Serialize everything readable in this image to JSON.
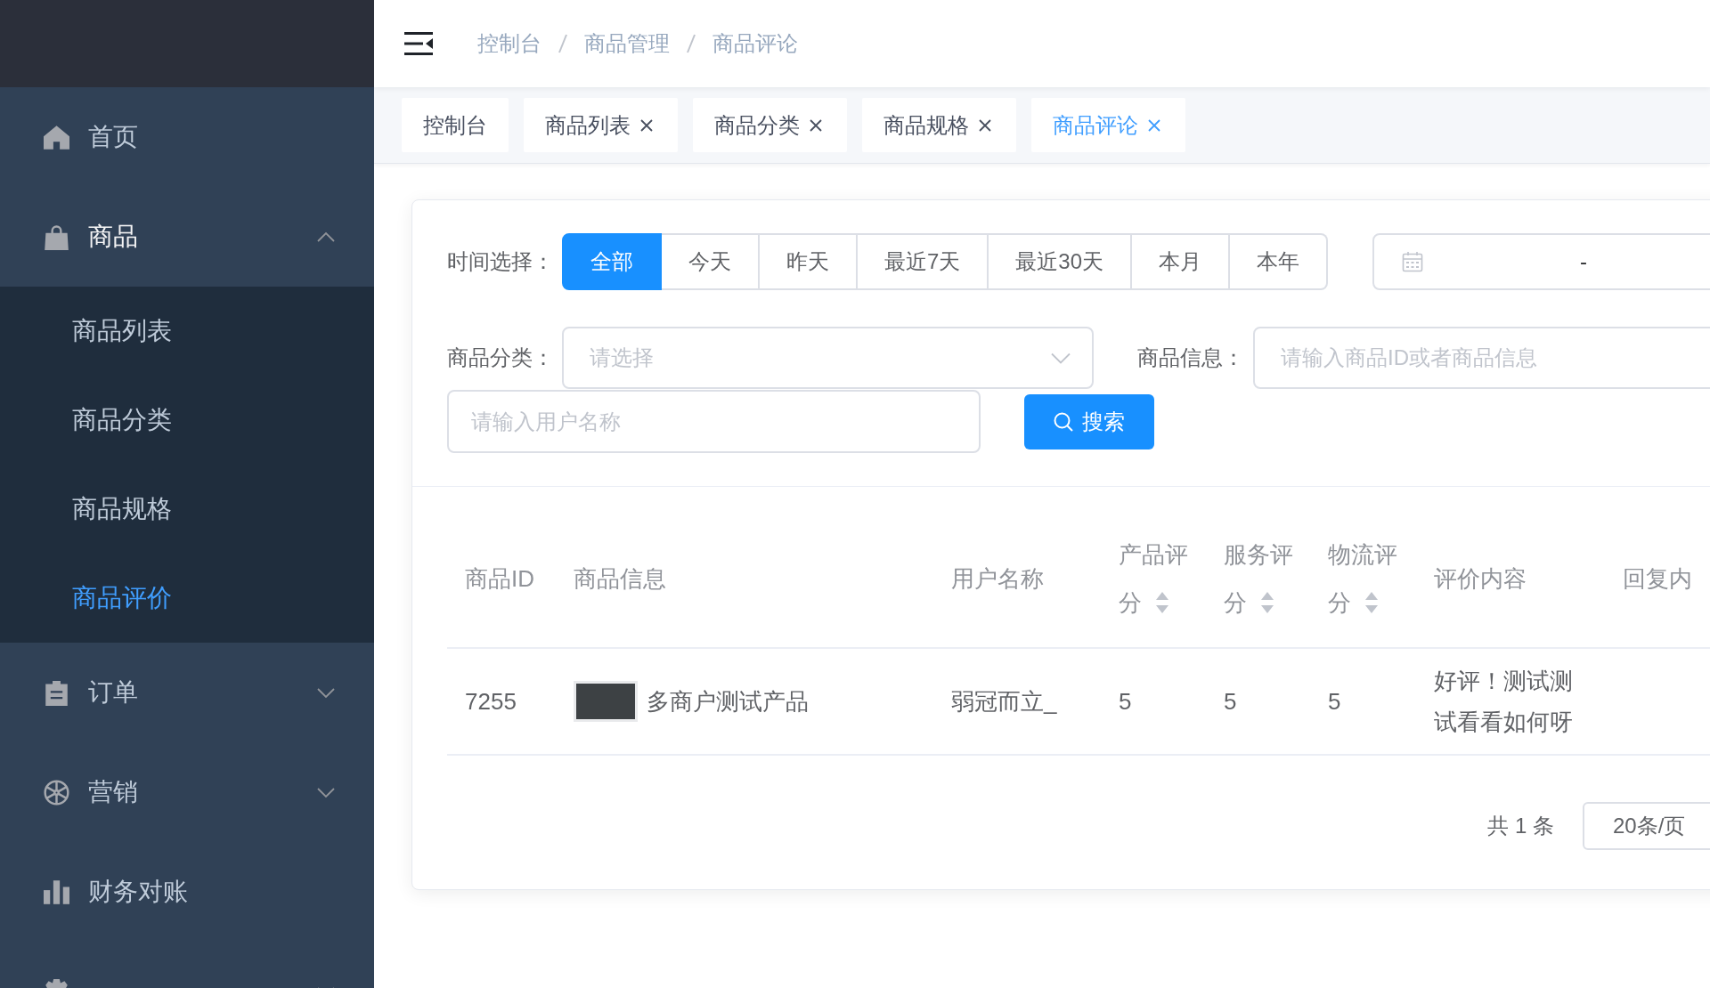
{
  "sidebar": {
    "items": [
      {
        "label": "首页",
        "selected": false
      },
      {
        "label": "商品",
        "selected": false,
        "expanded": true,
        "children": [
          {
            "label": "商品列表",
            "selected": false
          },
          {
            "label": "商品分类",
            "selected": false
          },
          {
            "label": "商品规格",
            "selected": false
          },
          {
            "label": "商品评价",
            "selected": true
          }
        ]
      },
      {
        "label": "订单",
        "selected": false,
        "expanded": false
      },
      {
        "label": "营销",
        "selected": false,
        "expanded": false
      },
      {
        "label": "财务对账",
        "selected": false
      },
      {
        "selected": false,
        "expanded": false
      }
    ]
  },
  "navbar": {
    "breadcrumb": [
      "控制台",
      "商品管理",
      "商品评论"
    ]
  },
  "tags": [
    {
      "label": "控制台",
      "selected": false,
      "closable": false
    },
    {
      "label": "商品列表",
      "selected": false,
      "closable": true
    },
    {
      "label": "商品分类",
      "selected": false,
      "closable": true
    },
    {
      "label": "商品规格",
      "selected": false,
      "closable": true
    },
    {
      "label": "商品评论",
      "selected": true,
      "closable": true
    }
  ],
  "filters": {
    "time": {
      "label": "时间选择：",
      "options": [
        {
          "label": "全部",
          "selected": true
        },
        {
          "label": "今天",
          "selected": false
        },
        {
          "label": "昨天",
          "selected": false
        },
        {
          "label": "最近7天",
          "selected": false
        },
        {
          "label": "最近30天",
          "selected": false
        },
        {
          "label": "本月",
          "selected": false
        },
        {
          "label": "本年",
          "selected": false
        }
      ]
    },
    "date_range": {
      "separator": "-"
    },
    "category": {
      "label": "商品分类：",
      "placeholder": "请选择"
    },
    "product_info": {
      "label": "商品信息：",
      "placeholder": "请输入商品ID或者商品信息"
    },
    "username": {
      "placeholder": "请输入用户名称"
    },
    "search_button": {
      "label": "搜索"
    }
  },
  "table": {
    "columns": [
      {
        "label": "商品ID",
        "kind": "text"
      },
      {
        "label": "商品信息",
        "kind": "product"
      },
      {
        "label": "用户名称",
        "kind": "text"
      },
      {
        "label": "产品评分",
        "kind": "sortable"
      },
      {
        "label": "服务评分",
        "kind": "sortable"
      },
      {
        "label": "物流评分",
        "kind": "sortable"
      },
      {
        "label": "评价内容",
        "kind": "text"
      },
      {
        "label": "回复内",
        "kind": "text"
      }
    ],
    "rows": [
      {
        "cells": [
          "7255",
          "多商户测试产品",
          "弱冠而立_",
          "5",
          "5",
          "5",
          "好评！测试测试看看如何呀"
        ]
      }
    ]
  },
  "pagination": {
    "total": "共 1 条",
    "page_size": "20条/页"
  }
}
